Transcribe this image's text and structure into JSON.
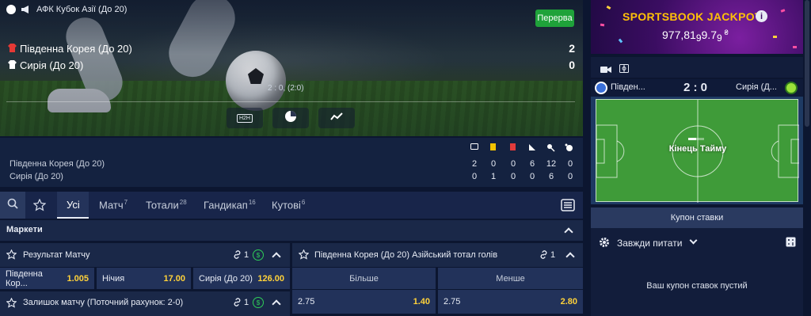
{
  "match": {
    "competition": "АФК Кубок Азії (До 20)",
    "status_badge": "Перерва",
    "home": {
      "name": "Південна Корея (До 20)",
      "score": "2"
    },
    "away": {
      "name": "Сирія (До 20)",
      "score": "0"
    },
    "timeline_label": "2 : 0, (2:0)",
    "h2h_label": "H2H"
  },
  "stats": {
    "rows": [
      {
        "name": "Південна Корея (До 20)",
        "values": [
          "2",
          "0",
          "0",
          "6",
          "12",
          "0"
        ]
      },
      {
        "name": "Сирія (До 20)",
        "values": [
          "0",
          "1",
          "0",
          "0",
          "6",
          "0"
        ]
      }
    ],
    "header_colors": [
      "#ffffff",
      "#f2c200",
      "#e33b3b",
      "#ffffff",
      "#ffffff",
      "#ffffff"
    ]
  },
  "tabs": [
    {
      "label": "Усі",
      "count": ""
    },
    {
      "label": "Матч",
      "count": "7"
    },
    {
      "label": "Тотали",
      "count": "28"
    },
    {
      "label": "Гандикап",
      "count": "16"
    },
    {
      "label": "Кутові",
      "count": "6"
    }
  ],
  "markets": {
    "header": "Маркети",
    "result": {
      "title": "Результат Матчу",
      "link_count": "1",
      "outcomes": [
        {
          "label": "Південна Кор...",
          "odd": "1.005"
        },
        {
          "label": "Нічия",
          "odd": "17.00"
        },
        {
          "label": "Сирія (До 20)",
          "odd": "126.00"
        }
      ]
    },
    "asian_total": {
      "title": "Південна Корея (До 20) Азійський тотал голів",
      "link_count": "1",
      "col_over": "Більше",
      "col_under": "Менше",
      "line_over": "2.75",
      "odd_over": "1.40",
      "line_under": "2.75",
      "odd_under": "2.80"
    },
    "remainder": {
      "title": "Залишок матчу (Поточний рахунок: 2-0)",
      "link_count": "1"
    }
  },
  "jackpot": {
    "title": "SPORTSBOOK JACKPOT",
    "amount": "977,81",
    "amount_tail": "9.7",
    "amount_tail2": "9",
    "currency": "₴"
  },
  "tracker": {
    "home_short": "Півден...",
    "score": "2 : 0",
    "away_short": "Сирія (Д...",
    "pitch_status": "Кінець Тайму"
  },
  "coupon": {
    "title": "Купон ставки",
    "setting_label": "Завжди питати",
    "empty_message": "Ваш купон ставок пустий"
  },
  "colors": {
    "accent_green": "#1fa23a",
    "odd_yellow": "#ffd23a",
    "jackpot_gold": "#ffc107",
    "dollar_green": "#2fcf58"
  }
}
